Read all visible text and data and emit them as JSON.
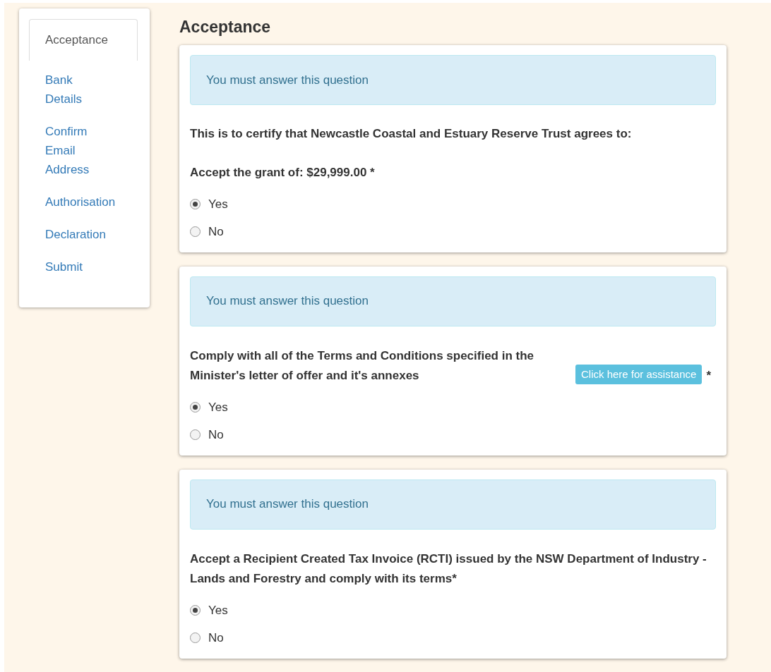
{
  "sidebar": {
    "items": [
      {
        "label": "Acceptance",
        "selected": true
      },
      {
        "label": "Bank Details",
        "selected": false
      },
      {
        "label": "Confirm Email Address",
        "selected": false
      },
      {
        "label": "Authorisation",
        "selected": false
      },
      {
        "label": "Declaration",
        "selected": false
      },
      {
        "label": "Submit",
        "selected": false
      }
    ]
  },
  "heading": "Acceptance",
  "questions": [
    {
      "alert": "You must answer this question",
      "intro": "This is to certify that Newcastle Coastal and Estuary Reserve Trust agrees to:",
      "text": "Accept the grant of: $29,999.00 *",
      "options": [
        {
          "label": "Yes",
          "selected": true
        },
        {
          "label": "No",
          "selected": false
        }
      ]
    },
    {
      "alert": "You must answer this question",
      "text": "Comply with all of the Terms and Conditions specified in the Minister's letter of offer and it's annexes",
      "help_button": "Click here for assistance",
      "suffix": "*",
      "options": [
        {
          "label": "Yes",
          "selected": true
        },
        {
          "label": "No",
          "selected": false
        }
      ]
    },
    {
      "alert": "You must answer this question",
      "text": "Accept a Recipient Created Tax Invoice (RCTI) issued by the NSW Department of Industry - Lands and Forestry and comply with its terms*",
      "options": [
        {
          "label": "Yes",
          "selected": true
        },
        {
          "label": "No",
          "selected": false
        }
      ]
    }
  ]
}
